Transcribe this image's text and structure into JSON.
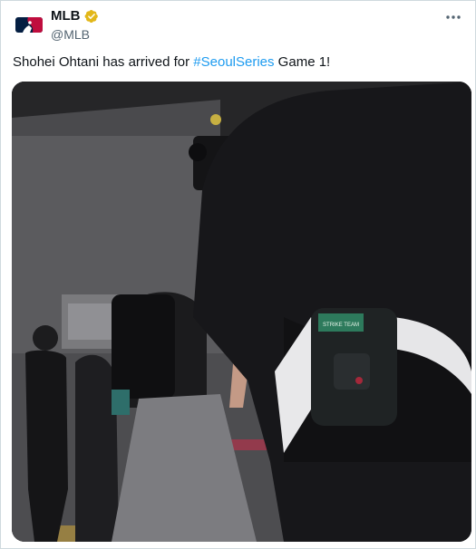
{
  "tweet": {
    "author": {
      "display_name": "MLB",
      "handle": "@MLB",
      "verified_badge": "gold-verified-badge-icon",
      "avatar": "mlb-logo-icon"
    },
    "more_options_icon": "more-horizontal-icon",
    "text_before": "Shohei Ohtani has arrived for ",
    "hashtag": "#SeoulSeries",
    "text_after": " Game 1!",
    "media": {
      "type": "video",
      "patch_text": "STRIKE TEAM"
    }
  },
  "colors": {
    "link": "#1d9bf0",
    "text": "#0f1419",
    "secondary": "#536471",
    "verified_gold": "#e2b719",
    "mlb_blue": "#041e42",
    "mlb_red": "#bf0d3e"
  }
}
